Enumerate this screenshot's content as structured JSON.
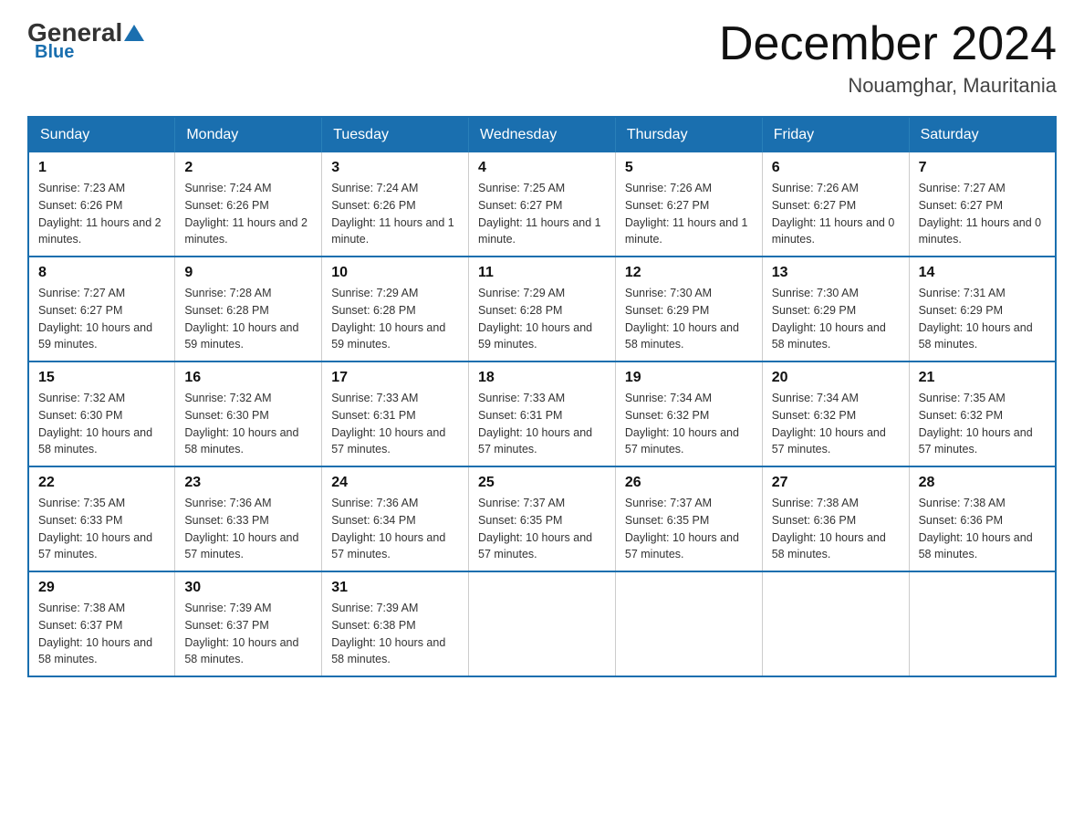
{
  "logo": {
    "general": "General",
    "blue": "Blue"
  },
  "title": {
    "month": "December 2024",
    "location": "Nouamghar, Mauritania"
  },
  "days_of_week": [
    "Sunday",
    "Monday",
    "Tuesday",
    "Wednesday",
    "Thursday",
    "Friday",
    "Saturday"
  ],
  "weeks": [
    [
      {
        "day": "1",
        "sunrise": "7:23 AM",
        "sunset": "6:26 PM",
        "daylight": "11 hours and 2 minutes."
      },
      {
        "day": "2",
        "sunrise": "7:24 AM",
        "sunset": "6:26 PM",
        "daylight": "11 hours and 2 minutes."
      },
      {
        "day": "3",
        "sunrise": "7:24 AM",
        "sunset": "6:26 PM",
        "daylight": "11 hours and 1 minute."
      },
      {
        "day": "4",
        "sunrise": "7:25 AM",
        "sunset": "6:27 PM",
        "daylight": "11 hours and 1 minute."
      },
      {
        "day": "5",
        "sunrise": "7:26 AM",
        "sunset": "6:27 PM",
        "daylight": "11 hours and 1 minute."
      },
      {
        "day": "6",
        "sunrise": "7:26 AM",
        "sunset": "6:27 PM",
        "daylight": "11 hours and 0 minutes."
      },
      {
        "day": "7",
        "sunrise": "7:27 AM",
        "sunset": "6:27 PM",
        "daylight": "11 hours and 0 minutes."
      }
    ],
    [
      {
        "day": "8",
        "sunrise": "7:27 AM",
        "sunset": "6:27 PM",
        "daylight": "10 hours and 59 minutes."
      },
      {
        "day": "9",
        "sunrise": "7:28 AM",
        "sunset": "6:28 PM",
        "daylight": "10 hours and 59 minutes."
      },
      {
        "day": "10",
        "sunrise": "7:29 AM",
        "sunset": "6:28 PM",
        "daylight": "10 hours and 59 minutes."
      },
      {
        "day": "11",
        "sunrise": "7:29 AM",
        "sunset": "6:28 PM",
        "daylight": "10 hours and 59 minutes."
      },
      {
        "day": "12",
        "sunrise": "7:30 AM",
        "sunset": "6:29 PM",
        "daylight": "10 hours and 58 minutes."
      },
      {
        "day": "13",
        "sunrise": "7:30 AM",
        "sunset": "6:29 PM",
        "daylight": "10 hours and 58 minutes."
      },
      {
        "day": "14",
        "sunrise": "7:31 AM",
        "sunset": "6:29 PM",
        "daylight": "10 hours and 58 minutes."
      }
    ],
    [
      {
        "day": "15",
        "sunrise": "7:32 AM",
        "sunset": "6:30 PM",
        "daylight": "10 hours and 58 minutes."
      },
      {
        "day": "16",
        "sunrise": "7:32 AM",
        "sunset": "6:30 PM",
        "daylight": "10 hours and 58 minutes."
      },
      {
        "day": "17",
        "sunrise": "7:33 AM",
        "sunset": "6:31 PM",
        "daylight": "10 hours and 57 minutes."
      },
      {
        "day": "18",
        "sunrise": "7:33 AM",
        "sunset": "6:31 PM",
        "daylight": "10 hours and 57 minutes."
      },
      {
        "day": "19",
        "sunrise": "7:34 AM",
        "sunset": "6:32 PM",
        "daylight": "10 hours and 57 minutes."
      },
      {
        "day": "20",
        "sunrise": "7:34 AM",
        "sunset": "6:32 PM",
        "daylight": "10 hours and 57 minutes."
      },
      {
        "day": "21",
        "sunrise": "7:35 AM",
        "sunset": "6:32 PM",
        "daylight": "10 hours and 57 minutes."
      }
    ],
    [
      {
        "day": "22",
        "sunrise": "7:35 AM",
        "sunset": "6:33 PM",
        "daylight": "10 hours and 57 minutes."
      },
      {
        "day": "23",
        "sunrise": "7:36 AM",
        "sunset": "6:33 PM",
        "daylight": "10 hours and 57 minutes."
      },
      {
        "day": "24",
        "sunrise": "7:36 AM",
        "sunset": "6:34 PM",
        "daylight": "10 hours and 57 minutes."
      },
      {
        "day": "25",
        "sunrise": "7:37 AM",
        "sunset": "6:35 PM",
        "daylight": "10 hours and 57 minutes."
      },
      {
        "day": "26",
        "sunrise": "7:37 AM",
        "sunset": "6:35 PM",
        "daylight": "10 hours and 57 minutes."
      },
      {
        "day": "27",
        "sunrise": "7:38 AM",
        "sunset": "6:36 PM",
        "daylight": "10 hours and 58 minutes."
      },
      {
        "day": "28",
        "sunrise": "7:38 AM",
        "sunset": "6:36 PM",
        "daylight": "10 hours and 58 minutes."
      }
    ],
    [
      {
        "day": "29",
        "sunrise": "7:38 AM",
        "sunset": "6:37 PM",
        "daylight": "10 hours and 58 minutes."
      },
      {
        "day": "30",
        "sunrise": "7:39 AM",
        "sunset": "6:37 PM",
        "daylight": "10 hours and 58 minutes."
      },
      {
        "day": "31",
        "sunrise": "7:39 AM",
        "sunset": "6:38 PM",
        "daylight": "10 hours and 58 minutes."
      },
      null,
      null,
      null,
      null
    ]
  ],
  "labels": {
    "sunrise": "Sunrise:",
    "sunset": "Sunset:",
    "daylight": "Daylight:"
  }
}
